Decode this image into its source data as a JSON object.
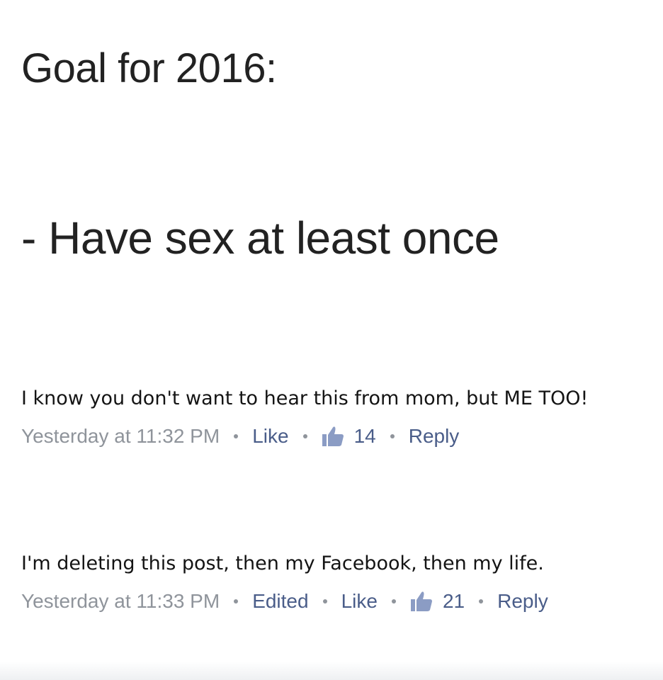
{
  "post": {
    "title": "Goal for 2016:",
    "body": "- Have sex at least once"
  },
  "comments": [
    {
      "text": "I know you don't want to hear this from mom, but ME TOO!",
      "timestamp": "Yesterday at 11:32 PM",
      "edited_label": null,
      "like_label": "Like",
      "like_count": "14",
      "reply_label": "Reply"
    },
    {
      "text": "I'm deleting this post, then my Facebook, then my life.",
      "timestamp": "Yesterday at 11:33 PM",
      "edited_label": "Edited",
      "like_label": "Like",
      "like_count": "21",
      "reply_label": "Reply"
    }
  ],
  "icons": {
    "like_count_icon": "thumbs-up-icon"
  },
  "colors": {
    "link": "#4a5d89",
    "meta_gray": "#8f949b",
    "like_icon": "#8b9cc4"
  }
}
